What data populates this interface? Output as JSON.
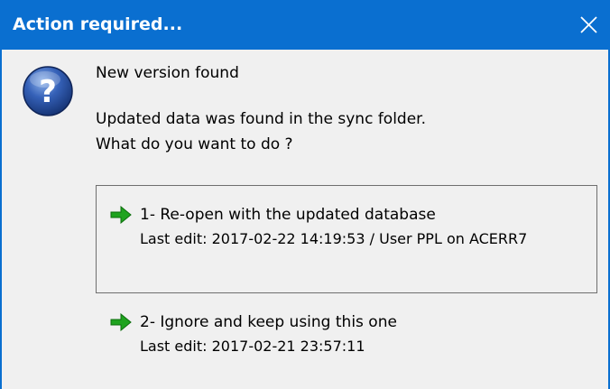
{
  "window": {
    "title": "Action required...",
    "close_icon": "close-icon",
    "accent_color": "#0a6fd0"
  },
  "content": {
    "icon": "question-icon",
    "heading": "New version found",
    "message_line1": "Updated data was found in the sync folder.",
    "message_line2": "What do you want to do ?"
  },
  "options": [
    {
      "icon": "green-arrow-icon",
      "title": "1- Re-open with the updated database",
      "detail": "Last edit: 2017-02-22 14:19:53 / User PPL on ACERR7"
    },
    {
      "icon": "green-arrow-icon",
      "title": "2- Ignore and keep using this one",
      "detail": "Last edit: 2017-02-21 23:57:11"
    }
  ]
}
